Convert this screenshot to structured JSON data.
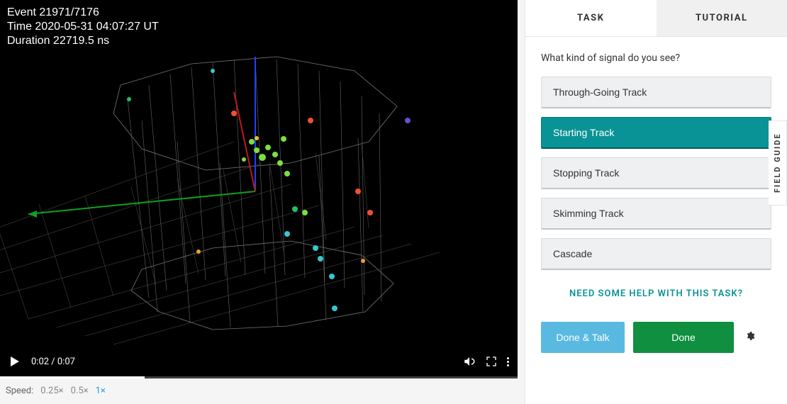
{
  "viewer": {
    "event_line": "Event 21971/7176",
    "time_line": "Time 2020-05-31 04:07:27 UT",
    "duration_line": "Duration 22719.5 ns",
    "video": {
      "current": "0:02",
      "total": "0:07",
      "progress_pct": 28
    }
  },
  "speed": {
    "label": "Speed:",
    "options": [
      "0.25×",
      "0.5×",
      "1×"
    ],
    "selected": "1×"
  },
  "tabs": {
    "task": "TASK",
    "tutorial": "TUTORIAL"
  },
  "task": {
    "question": "What kind of signal do you see?",
    "options": [
      "Through-Going Track",
      "Starting Track",
      "Stopping Track",
      "Skimming Track",
      "Cascade"
    ],
    "selected_index": 1,
    "help": "NEED SOME HELP WITH THIS TASK?"
  },
  "actions": {
    "done_talk": "Done & Talk",
    "done": "Done"
  },
  "field_guide": "FIELD GUIDE"
}
